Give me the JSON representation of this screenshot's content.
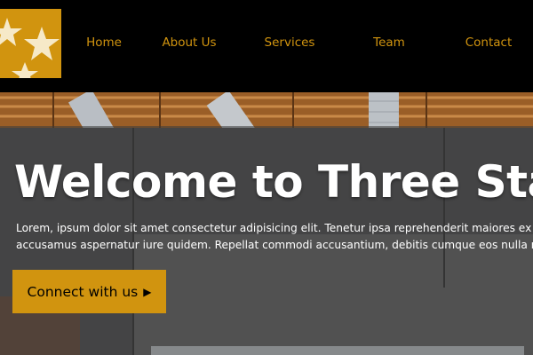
{
  "nav": {
    "items": [
      {
        "label": "Home"
      },
      {
        "label": "About Us"
      },
      {
        "label": "Services"
      },
      {
        "label": "Team"
      },
      {
        "label": "Contact"
      }
    ]
  },
  "hero": {
    "title": "Welcome to Three Stars",
    "text_line1": "Lorem, ipsum dolor sit amet consectetur adipisicing elit. Tenetur ipsa reprehenderit maiores ex ut",
    "text_line2": "accusamus aspernatur iure quidem. Repellat commodi accusantium, debitis cumque eos nulla nam",
    "cta_label": "Connect with us",
    "cta_icon": "caret-right-icon"
  },
  "colors": {
    "accent": "#d1940f",
    "header_bg": "#000000",
    "text_light": "#ffffff"
  },
  "logo": {
    "icon": "three-stars-logo"
  }
}
